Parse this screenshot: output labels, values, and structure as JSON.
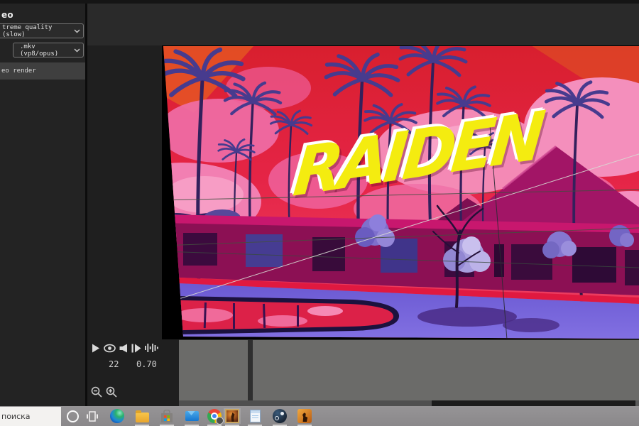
{
  "app": {
    "left_panel": {
      "title": "eo",
      "quality_option": "treme quality (slow)",
      "format_option": ".mkv (vp8/opus)",
      "render_label": "eo render"
    },
    "preview": {
      "overlay_text": "RAIDEN",
      "scene_description": "synthwave artwork: pink-red sky, pink clouds, indigo palm silhouettes, magenta mountains, purple motel with neon stripe, violet deck and red reflecting pool",
      "colors": {
        "sky_top": "#d81f2e",
        "sky_bottom": "#ef4468",
        "cloud_pink": "#f48fbc",
        "palm_indigo": "#473b8e",
        "mountain_magenta": "#a21566",
        "building_facade": "#8c1054",
        "neon_stripe": "#e01940",
        "deck_violet": "#7265d8",
        "pool_red": "#dc2148",
        "title_yellow": "#f4ec10"
      }
    },
    "timeline": {
      "controls": [
        "play-icon",
        "eye-icon",
        "speaker-icon",
        "frame-step-icon",
        "waveform-icon"
      ],
      "frame_number": "22",
      "speed_value": "0.70",
      "zoom_buttons": [
        "zoom-out",
        "zoom-in"
      ]
    }
  },
  "taskbar": {
    "search_text": "поиска",
    "icons": [
      "cortana",
      "task-view",
      "edge",
      "file-explorer",
      "microsoft-store",
      "mail",
      "chrome",
      "painting-app",
      "notepad",
      "steam",
      "csgo"
    ],
    "running_apps": [
      "file-explorer",
      "microsoft-store",
      "mail",
      "chrome",
      "painting-app",
      "notepad",
      "steam",
      "csgo"
    ]
  }
}
